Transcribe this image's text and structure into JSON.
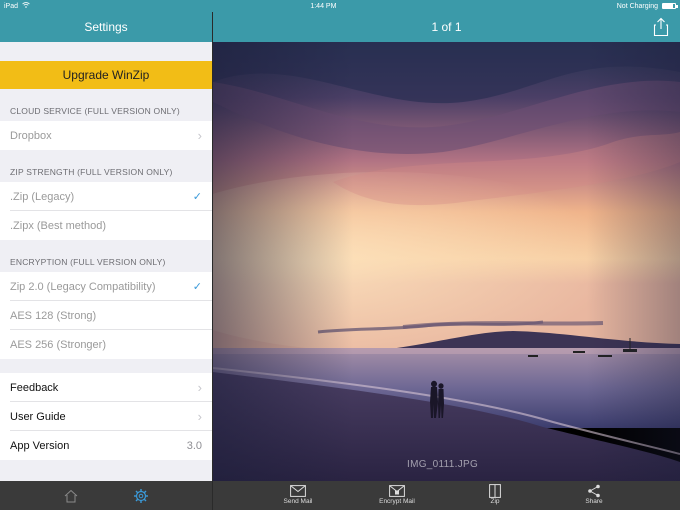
{
  "status": {
    "device": "iPad",
    "time": "1:44 PM",
    "charge": "Not Charging",
    "battery_level": 0.85
  },
  "settings": {
    "title": "Settings",
    "upgrade": "Upgrade WinZip",
    "cloud_header": "CLOUD SERVICE (FULL VERSION ONLY)",
    "cloud_items": [
      {
        "label": "Dropbox"
      }
    ],
    "zip_header": "ZIP STRENGTH (FULL VERSION ONLY)",
    "zip_items": [
      {
        "label": ".Zip (Legacy)",
        "checked": true
      },
      {
        "label": ".Zipx (Best method)",
        "checked": false
      }
    ],
    "enc_header": "ENCRYPTION (FULL VERSION ONLY)",
    "enc_items": [
      {
        "label": "Zip 2.0 (Legacy Compatibility)",
        "checked": true
      },
      {
        "label": "AES 128 (Strong)",
        "checked": false
      },
      {
        "label": "AES 256 (Stronger)",
        "checked": false
      }
    ],
    "misc_items": [
      {
        "label": "Feedback"
      },
      {
        "label": "User Guide"
      },
      {
        "label": "App Version",
        "value": "3.0"
      }
    ]
  },
  "left_tabs": [
    {
      "icon": "home-icon"
    },
    {
      "icon": "gear-icon",
      "active": true
    }
  ],
  "viewer": {
    "counter": "1 of 1",
    "filename": "IMG_0111.JPG"
  },
  "toolbar": [
    {
      "label": "Send Mail",
      "icon": "mail-icon"
    },
    {
      "label": "Encrypt Mail",
      "icon": "encrypt-mail-icon"
    },
    {
      "label": "Zip",
      "icon": "zip-icon"
    },
    {
      "label": "Share",
      "icon": "share-icon"
    }
  ],
  "colors": {
    "accent": "#3b9aa9",
    "upgrade": "#f2bd16",
    "check": "#3a9ad9",
    "toolbar": "#3a3a3a"
  }
}
